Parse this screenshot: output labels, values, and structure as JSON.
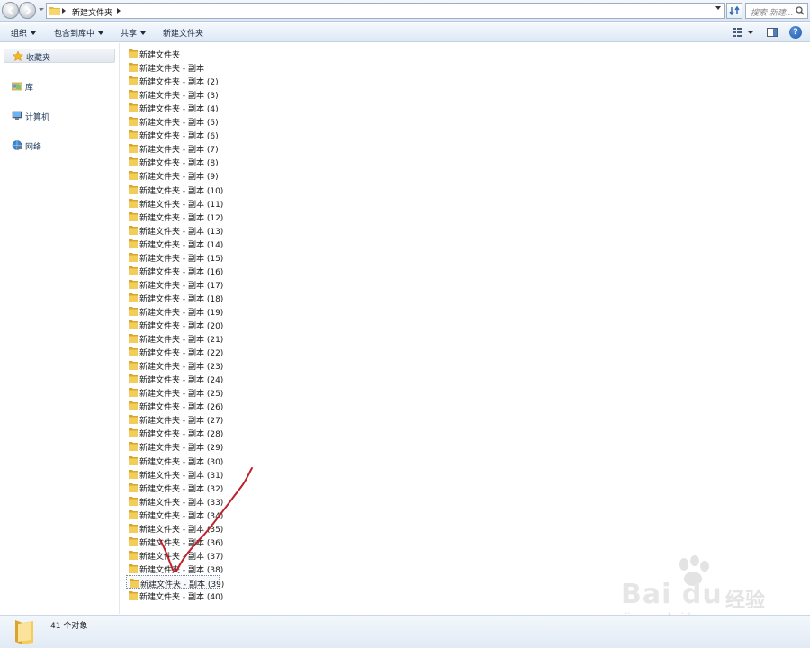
{
  "address": {
    "path": [
      "新建文件夹"
    ],
    "search_placeholder": "搜索 新建..."
  },
  "toolbar": {
    "organize": "组织",
    "include_in_library": "包含到库中",
    "share": "共享",
    "new_folder": "新建文件夹",
    "help": "?"
  },
  "sidebar": {
    "items": [
      {
        "label": "收藏夹",
        "icon": "star-icon"
      },
      {
        "label": "库",
        "icon": "library-icon"
      },
      {
        "label": "计算机",
        "icon": "computer-icon"
      },
      {
        "label": "网络",
        "icon": "network-icon"
      }
    ]
  },
  "files": [
    "新建文件夹",
    "新建文件夹 - 副本",
    "新建文件夹 - 副本 (2)",
    "新建文件夹 - 副本 (3)",
    "新建文件夹 - 副本 (4)",
    "新建文件夹 - 副本 (5)",
    "新建文件夹 - 副本 (6)",
    "新建文件夹 - 副本 (7)",
    "新建文件夹 - 副本 (8)",
    "新建文件夹 - 副本 (9)",
    "新建文件夹 - 副本 (10)",
    "新建文件夹 - 副本 (11)",
    "新建文件夹 - 副本 (12)",
    "新建文件夹 - 副本 (13)",
    "新建文件夹 - 副本 (14)",
    "新建文件夹 - 副本 (15)",
    "新建文件夹 - 副本 (16)",
    "新建文件夹 - 副本 (17)",
    "新建文件夹 - 副本 (18)",
    "新建文件夹 - 副本 (19)",
    "新建文件夹 - 副本 (20)",
    "新建文件夹 - 副本 (21)",
    "新建文件夹 - 副本 (22)",
    "新建文件夹 - 副本 (23)",
    "新建文件夹 - 副本 (24)",
    "新建文件夹 - 副本 (25)",
    "新建文件夹 - 副本 (26)",
    "新建文件夹 - 副本 (27)",
    "新建文件夹 - 副本 (28)",
    "新建文件夹 - 副本 (29)",
    "新建文件夹 - 副本 (30)",
    "新建文件夹 - 副本 (31)",
    "新建文件夹 - 副本 (32)",
    "新建文件夹 - 副本 (33)",
    "新建文件夹 - 副本 (34)",
    "新建文件夹 - 副本 (35)",
    "新建文件夹 - 副本 (36)",
    "新建文件夹 - 副本 (37)",
    "新建文件夹 - 副本 (38)",
    "新建文件夹 - 副本 (39)",
    "新建文件夹 - 副本 (40)"
  ],
  "selected_file": "新建文件夹 - 副本 (39)",
  "status": {
    "count_text": "41 个对象"
  },
  "watermark": {
    "brand": "Bai du",
    "brand_cn": "经验",
    "url": "jingyan.baidu.com"
  },
  "colors": {
    "folder": "#f0c64a",
    "annotation": "#c0202a",
    "accent": "#1e5bb0"
  }
}
